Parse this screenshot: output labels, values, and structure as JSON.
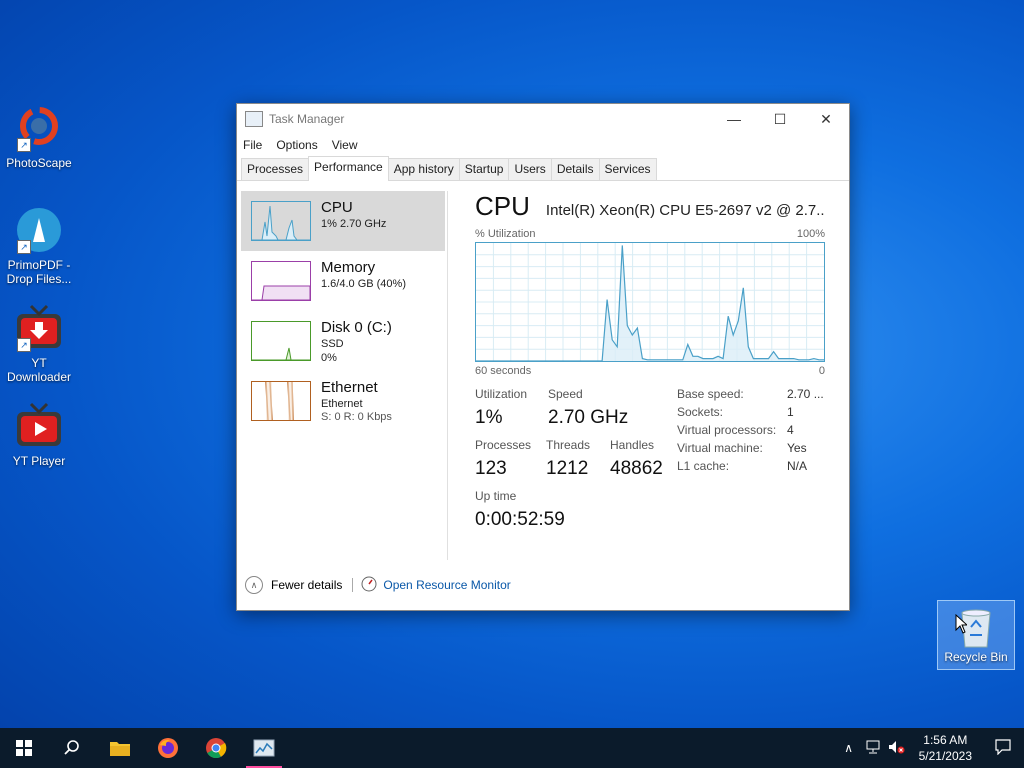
{
  "desktop": {
    "icons": [
      {
        "label": "PhotoScape"
      },
      {
        "label": "PrimoPDF - Drop Files..."
      },
      {
        "label": "YT Downloader"
      },
      {
        "label": "YT Player"
      }
    ],
    "recycle_bin": "Recycle Bin"
  },
  "window": {
    "title": "Task Manager",
    "menu": [
      "File",
      "Options",
      "View"
    ],
    "tabs": [
      "Processes",
      "Performance",
      "App history",
      "Startup",
      "Users",
      "Details",
      "Services"
    ],
    "active_tab": "Performance",
    "sidebar": [
      {
        "name": "CPU",
        "sub": "1%  2.70 GHz",
        "sub2": ""
      },
      {
        "name": "Memory",
        "sub": "1.6/4.0 GB (40%)",
        "sub2": ""
      },
      {
        "name": "Disk 0 (C:)",
        "sub": "SSD",
        "sub2": "0%"
      },
      {
        "name": "Ethernet",
        "sub": "Ethernet",
        "sub2": "S: 0  R: 0 Kbps"
      }
    ],
    "main": {
      "title": "CPU",
      "model": "Intel(R) Xeon(R) CPU E5-2697 v2 @ 2.7...",
      "graph_label_left": "% Utilization",
      "graph_label_right": "100%",
      "axis_left": "60 seconds",
      "axis_right": "0",
      "utilization_series": [
        0,
        0,
        0,
        0,
        0,
        0,
        0,
        0,
        0,
        0,
        0,
        0,
        0,
        0,
        0,
        0,
        0,
        0,
        0,
        0,
        0,
        0,
        0,
        0,
        0,
        0,
        52,
        18,
        12,
        98,
        30,
        22,
        28,
        2,
        1,
        1,
        1,
        1,
        1,
        1,
        1,
        1,
        14,
        4,
        4,
        2,
        2,
        2,
        4,
        2,
        38,
        22,
        34,
        62,
        12,
        2,
        2,
        2,
        2,
        8,
        2,
        2,
        2,
        2,
        1,
        1,
        1,
        2,
        1,
        1
      ],
      "stats": {
        "utilization_label": "Utilization",
        "utilization": "1%",
        "speed_label": "Speed",
        "speed": "2.70 GHz",
        "processes_label": "Processes",
        "processes": "123",
        "threads_label": "Threads",
        "threads": "1212",
        "handles_label": "Handles",
        "handles": "48862",
        "uptime_label": "Up time",
        "uptime": "0:00:52:59"
      },
      "specs": [
        {
          "k": "Base speed:",
          "v": "2.70 ..."
        },
        {
          "k": "Sockets:",
          "v": "1"
        },
        {
          "k": "Virtual processors:",
          "v": "4"
        },
        {
          "k": "Virtual machine:",
          "v": "Yes"
        },
        {
          "k": "L1 cache:",
          "v": "N/A"
        }
      ]
    },
    "footer": {
      "fewer_details": "Fewer details",
      "resource_monitor": "Open Resource Monitor"
    }
  },
  "taskbar": {
    "time": "1:56 AM",
    "date": "5/21/2023"
  },
  "colors": {
    "cpu": "#4aa0c8",
    "memory": "#9b3fa8",
    "disk": "#4a9a2a",
    "ethernet": "#b06020"
  }
}
